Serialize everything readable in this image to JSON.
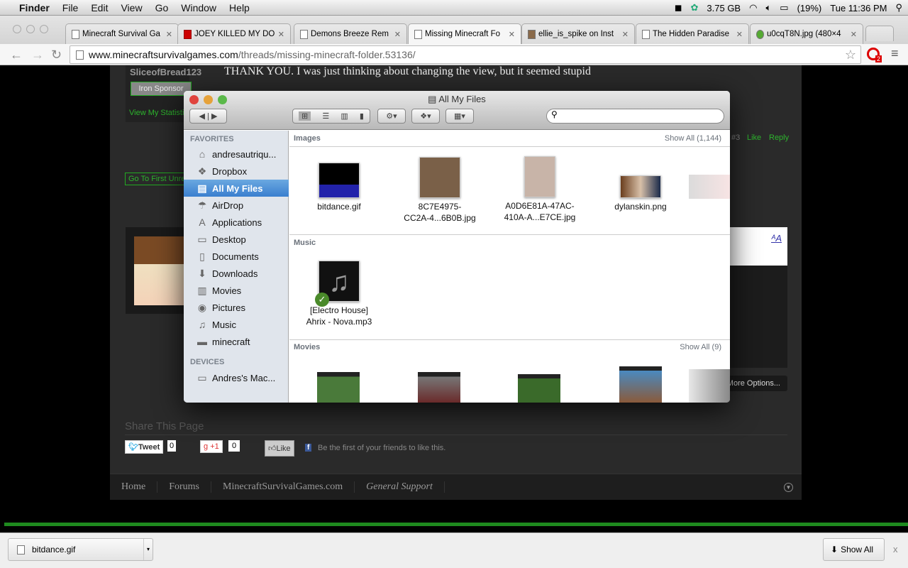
{
  "menubar": {
    "app": "Finder",
    "items": [
      "File",
      "Edit",
      "View",
      "Go",
      "Window",
      "Help"
    ],
    "memory": "3.75 GB",
    "battery": "(19%)",
    "clock": "Tue 11:36 PM"
  },
  "tabs": [
    {
      "title": "Minecraft Survival Ga"
    },
    {
      "title": "JOEY KILLED MY DOG"
    },
    {
      "title": "Demons Breeze Rem"
    },
    {
      "title": "Missing Minecraft Fo"
    },
    {
      "title": "ellie_is_spike on Inst"
    },
    {
      "title": "The Hidden Paradise"
    },
    {
      "title": "u0cqT8N.jpg (480×4"
    }
  ],
  "omnibox": {
    "host": "www.minecraftsurvivalgames.com",
    "path": "/threads/missing-minecraft-folder.53136/"
  },
  "extension_badge": "2",
  "forum": {
    "username": "SliceofBread123",
    "rank": "Iron Sponsor",
    "stats_link": "View My Statistics",
    "post_text": "THANK YOU. I was just thinking about changing the view, but it seemed stupid",
    "post_num": "#3",
    "like": "Like",
    "reply": "Reply",
    "first_unread": "Go To First Unread",
    "more_options": "More Options...",
    "share_title": "Share This Page",
    "tweet": "Tweet",
    "tweet_count": "0",
    "gplus": "+1",
    "gplus_count": "0",
    "fb_like": "Like",
    "fb_text": "Be the first of your friends to like this.",
    "breadcrumbs": [
      "Home",
      "Forums",
      "MinecraftSurvivalGames.com",
      "General Support"
    ]
  },
  "finder": {
    "title": "All My Files",
    "favorites_label": "FAVORITES",
    "devices_label": "DEVICES",
    "favorites": [
      {
        "label": "andresautriqu...",
        "icon": "home-icon"
      },
      {
        "label": "Dropbox",
        "icon": "dropbox-icon"
      },
      {
        "label": "All My Files",
        "icon": "all-files-icon",
        "selected": true
      },
      {
        "label": "AirDrop",
        "icon": "airdrop-icon"
      },
      {
        "label": "Applications",
        "icon": "applications-icon"
      },
      {
        "label": "Desktop",
        "icon": "desktop-icon"
      },
      {
        "label": "Documents",
        "icon": "documents-icon"
      },
      {
        "label": "Downloads",
        "icon": "downloads-icon"
      },
      {
        "label": "Movies",
        "icon": "movies-icon"
      },
      {
        "label": "Pictures",
        "icon": "pictures-icon"
      },
      {
        "label": "Music",
        "icon": "music-icon"
      },
      {
        "label": "minecraft",
        "icon": "folder-icon"
      }
    ],
    "devices": [
      {
        "label": "Andres's Mac...",
        "icon": "hard-drive-icon"
      }
    ],
    "sections": {
      "images": {
        "title": "Images",
        "show_all": "Show All (1,144)",
        "items": [
          "bitdance.gif",
          "8C7E4975-\nCC2A-4...6B0B.jpg",
          "A0D6E81A-47AC-\n410A-A...E7CE.jpg",
          "dylanskin.png"
        ]
      },
      "music": {
        "title": "Music",
        "items": [
          "[Electro House]\nAhrix - Nova.mp3"
        ]
      },
      "movies": {
        "title": "Movies",
        "show_all": "Show All (9)"
      }
    }
  },
  "downloads": {
    "file": "bitdance.gif",
    "show_all": "Show All",
    "close": "x"
  }
}
